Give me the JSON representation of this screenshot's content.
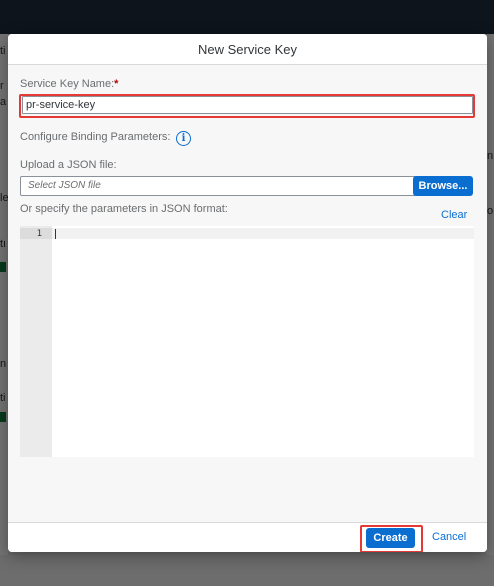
{
  "background": {
    "left_glyphs": [
      "ti",
      "r",
      "a",
      "le",
      "tı",
      "n",
      "ti"
    ],
    "right_glyphs": [
      "n",
      "o"
    ]
  },
  "dialog": {
    "title": "New Service Key",
    "service_key_name": {
      "label": "Service Key Name:",
      "required_marker": "*",
      "value": "pr-service-key"
    },
    "binding": {
      "label": "Configure Binding Parameters:",
      "info_icon": "i"
    },
    "upload": {
      "label": "Upload a JSON file:",
      "placeholder": "Select JSON file",
      "browse_label": "Browse..."
    },
    "json": {
      "label": "Or specify the parameters in JSON format:",
      "clear_label": "Clear",
      "line_numbers": [
        "1"
      ]
    },
    "footer": {
      "create_label": "Create",
      "cancel_label": "Cancel"
    }
  },
  "colors": {
    "accent": "#0a6ed1",
    "highlight": "#e53935",
    "required": "#bb0000",
    "shell": "#1d2d3e"
  }
}
